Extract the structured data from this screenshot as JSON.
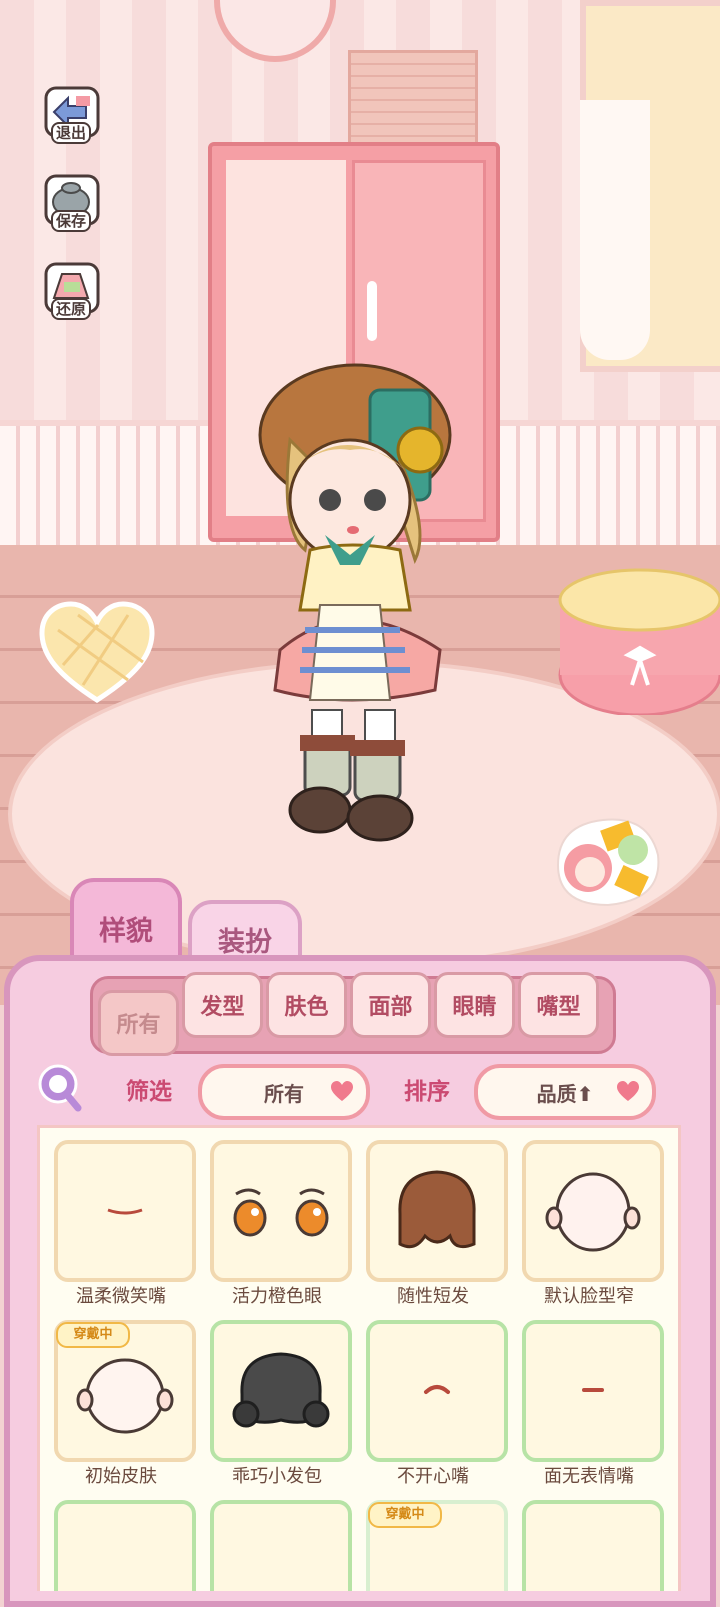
{
  "side_buttons": {
    "exit": "退出",
    "save": "保存",
    "restore": "还原"
  },
  "main_tabs": {
    "look": "样貌",
    "dress": "装扮"
  },
  "sub_tabs": [
    "所有",
    "发型",
    "肤色",
    "面部",
    "眼睛",
    "嘴型"
  ],
  "filter": {
    "label": "筛选",
    "value": "所有"
  },
  "sort": {
    "label": "排序",
    "value": "品质⬆"
  },
  "items": [
    {
      "name": "温柔微笑嘴",
      "art": "mouth-smile",
      "border": "tan"
    },
    {
      "name": "活力橙色眼",
      "art": "orange-eyes",
      "border": "tan"
    },
    {
      "name": "随性短发",
      "art": "brown-hair",
      "border": "tan"
    },
    {
      "name": "默认脸型窄",
      "art": "narrow-face",
      "border": "tan"
    },
    {
      "name": "初始皮肤",
      "art": "base-skin",
      "border": "tan",
      "badge": "穿戴中"
    },
    {
      "name": "乖巧小发包",
      "art": "black-bun-hair",
      "border": "green"
    },
    {
      "name": "不开心嘴",
      "art": "mouth-frown",
      "border": "green"
    },
    {
      "name": "面无表情嘴",
      "art": "mouth-flat",
      "border": "green"
    },
    {
      "name": "",
      "art": "",
      "border": "green"
    },
    {
      "name": "",
      "art": "",
      "border": "green"
    },
    {
      "name": "",
      "art": "",
      "border": "tan",
      "badge": "穿戴中"
    },
    {
      "name": "",
      "art": "",
      "border": "green"
    }
  ],
  "colors": {
    "panel_pink": "#f6cce0",
    "accent": "#cb4a72",
    "wearing_badge": "#f1b846"
  }
}
